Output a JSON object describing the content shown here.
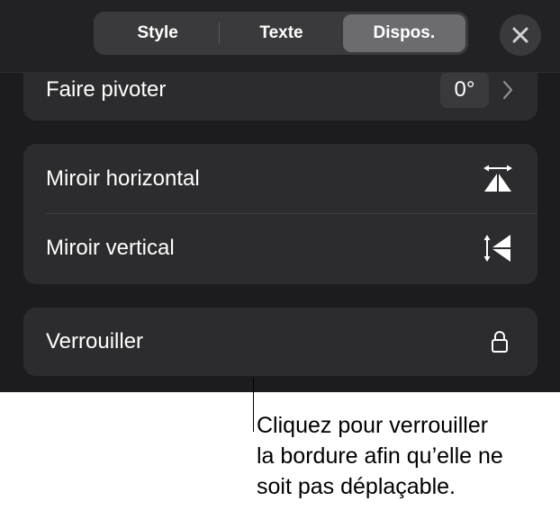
{
  "tabs": [
    {
      "label": "Style",
      "active": false
    },
    {
      "label": "Texte",
      "active": false
    },
    {
      "label": "Dispos.",
      "active": true
    }
  ],
  "header": {
    "close_icon": "close-icon"
  },
  "rotate": {
    "label": "Faire pivoter",
    "value": "0°",
    "chevron_icon": "chevron-right-icon"
  },
  "flip": {
    "horizontal_label": "Miroir horizontal",
    "horizontal_icon": "flip-horizontal-icon",
    "vertical_label": "Miroir vertical",
    "vertical_icon": "flip-vertical-icon"
  },
  "lock": {
    "label": "Verrouiller",
    "icon": "lock-icon"
  },
  "callout": {
    "lines": [
      "Cliquez pour verrouiller",
      "la bordure afin qu’elle ne",
      "soit pas déplaçable."
    ]
  },
  "colors": {
    "panel_bg": "#1c1c1e",
    "card_bg": "#2c2c2e",
    "active_tab": "#6c6c70",
    "text": "#ffffff"
  }
}
